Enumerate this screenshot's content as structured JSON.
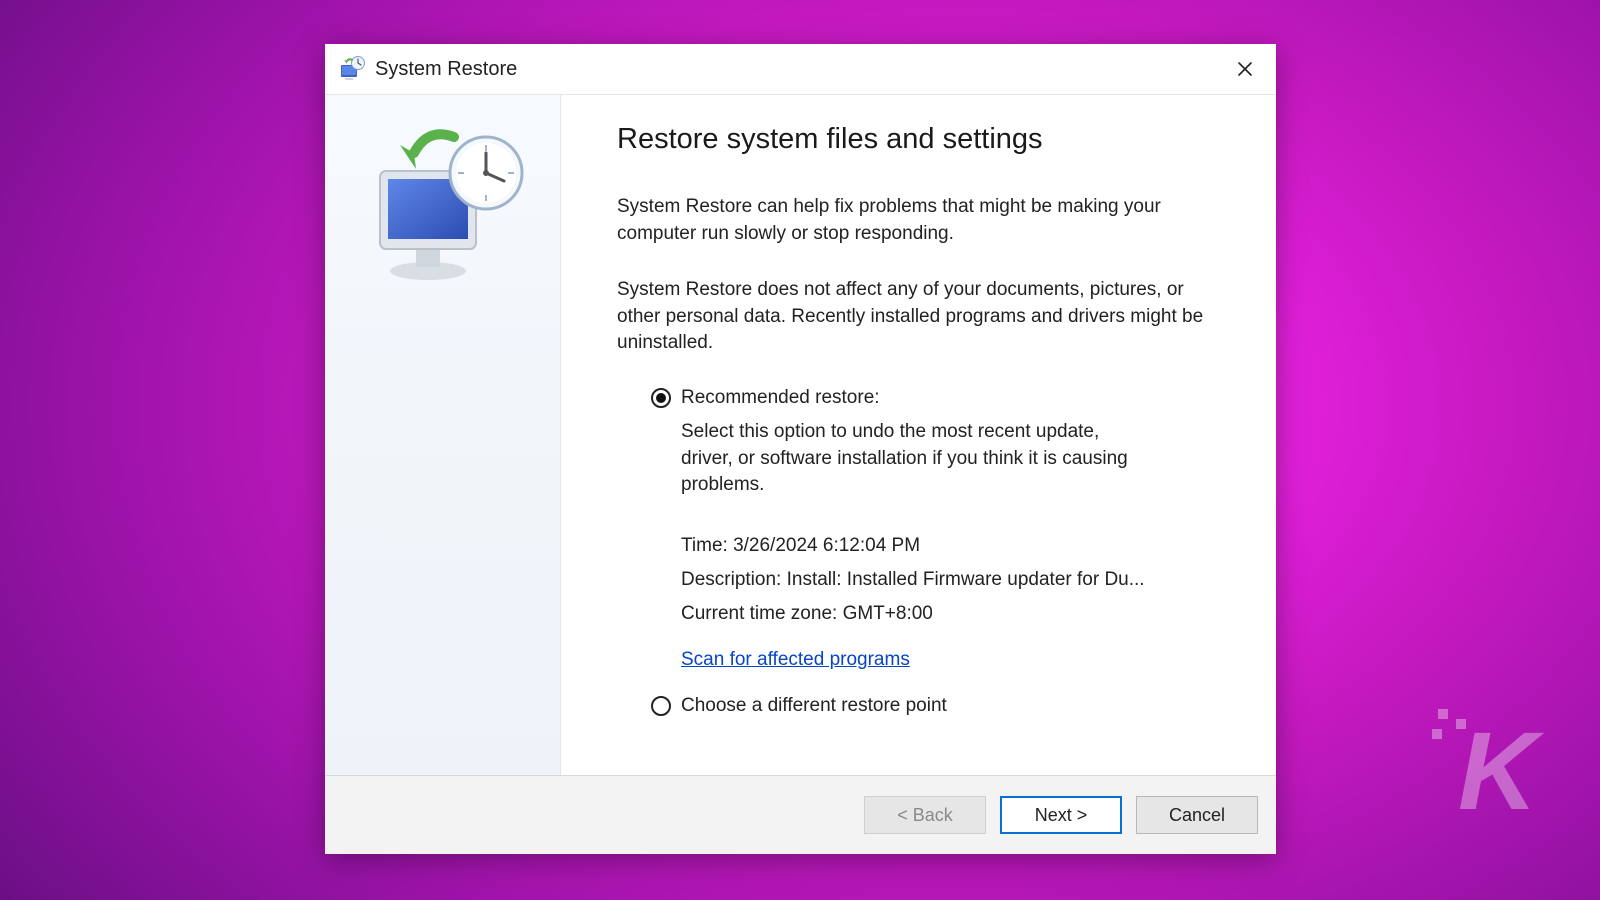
{
  "window": {
    "title": "System Restore"
  },
  "content": {
    "heading": "Restore system files and settings",
    "para1": "System Restore can help fix problems that might be making your computer run slowly or stop responding.",
    "para2": "System Restore does not affect any of your documents, pictures, or other personal data. Recently installed programs and drivers might be uninstalled.",
    "option_recommended": {
      "label": "Recommended restore:",
      "description": "Select this option to undo the most recent update, driver, or software installation if you think it is causing problems.",
      "time_line": "Time: 3/26/2024 6:12:04 PM",
      "description_line": "Description: Install: Installed Firmware updater for Du...",
      "timezone_line": "Current time zone: GMT+8:00",
      "scan_link": "Scan for affected programs"
    },
    "option_choose": {
      "label": "Choose a different restore point"
    }
  },
  "footer": {
    "back": "< Back",
    "next": "Next >",
    "cancel": "Cancel"
  }
}
